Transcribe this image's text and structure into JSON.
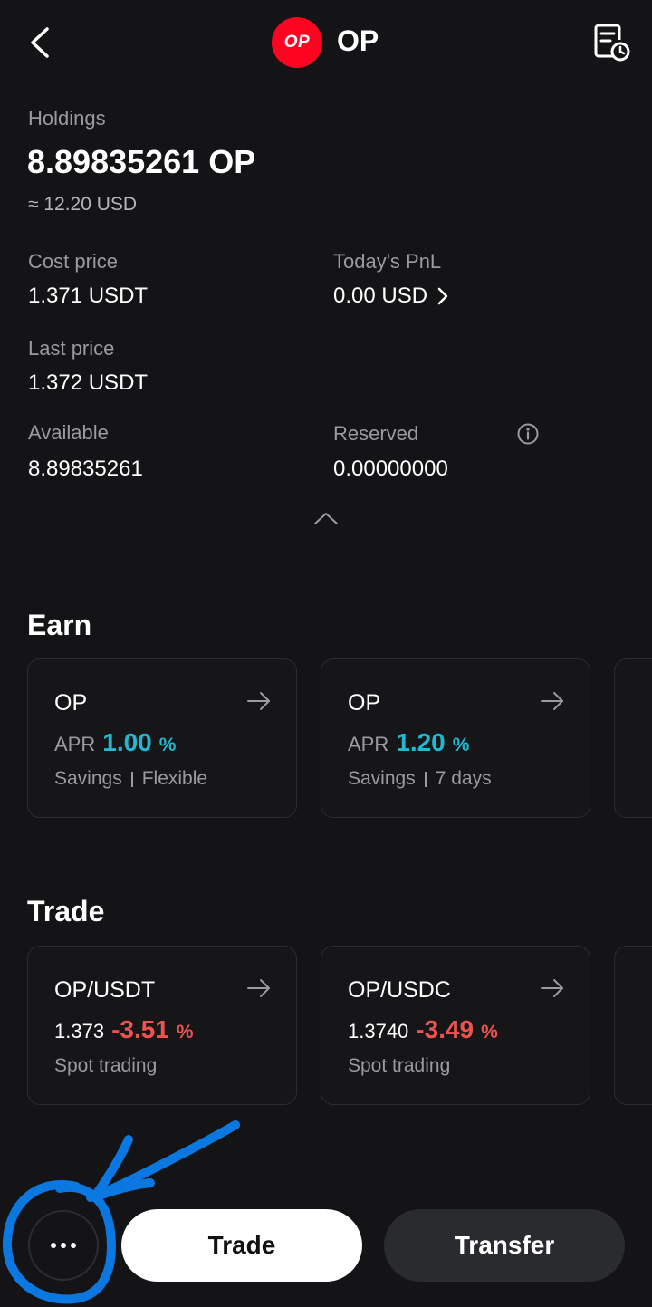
{
  "header": {
    "coin_logo_text": "OP",
    "title": "OP"
  },
  "holdings": {
    "label": "Holdings",
    "amount": "8.89835261 OP",
    "usd_value": "≈ 12.20 USD"
  },
  "stats": {
    "cost_price": {
      "label": "Cost price",
      "value": "1.371 USDT"
    },
    "todays_pnl": {
      "label": "Today's PnL",
      "value": "0.00 USD"
    },
    "last_price": {
      "label": "Last price",
      "value": "1.372 USDT"
    },
    "available": {
      "label": "Available",
      "value": "8.89835261"
    },
    "reserved": {
      "label": "Reserved",
      "value": "0.00000000"
    }
  },
  "earn": {
    "title": "Earn",
    "cards": [
      {
        "asset": "OP",
        "apr_label": "APR",
        "apr_value": "1.00",
        "apr_unit": "%",
        "product": "Savings",
        "term": "Flexible"
      },
      {
        "asset": "OP",
        "apr_label": "APR",
        "apr_value": "1.20",
        "apr_unit": "%",
        "product": "Savings",
        "term": "7 days"
      }
    ]
  },
  "trade": {
    "title": "Trade",
    "cards": [
      {
        "pair": "OP/USDT",
        "price": "1.373",
        "change": "-3.51",
        "change_unit": "%",
        "type": "Spot trading"
      },
      {
        "pair": "OP/USDC",
        "price": "1.3740",
        "change": "-3.49",
        "change_unit": "%",
        "type": "Spot trading"
      }
    ]
  },
  "bottom_bar": {
    "trade_label": "Trade",
    "transfer_label": "Transfer"
  },
  "colors": {
    "background": "#141416",
    "accent_apr": "#22b8cf",
    "negative": "#f0524f",
    "brand_op": "#ff0420",
    "annotation_blue": "#0a78e0"
  },
  "icons": [
    "back-arrow-icon",
    "history-icon",
    "chevron-right-icon",
    "info-icon",
    "chevron-up-icon",
    "arrow-right-icon",
    "more-dots-icon"
  ]
}
